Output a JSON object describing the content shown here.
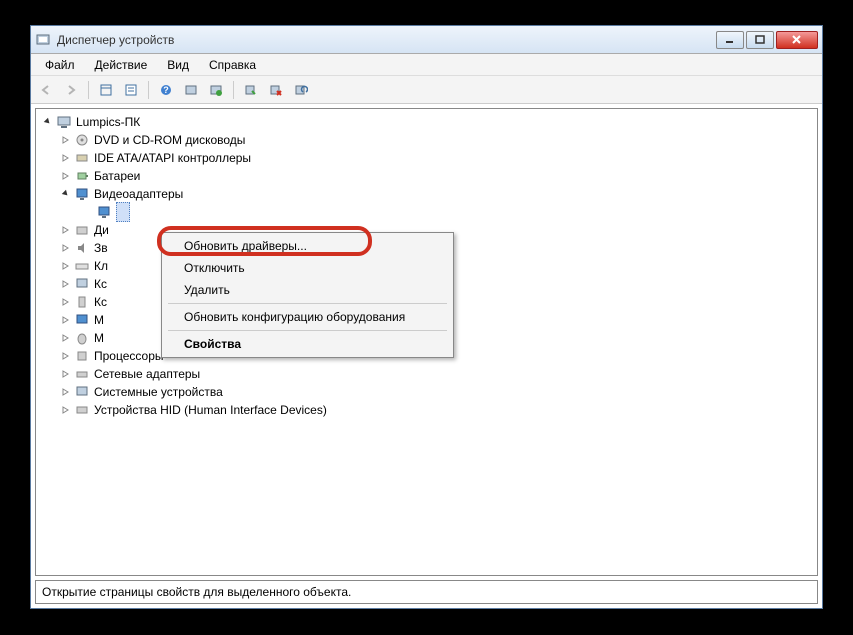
{
  "window": {
    "title": "Диспетчер устройств"
  },
  "menu": {
    "file": "Файл",
    "action": "Действие",
    "view": "Вид",
    "help": "Справка"
  },
  "tree": {
    "root": "Lumpics-ПК",
    "items": [
      {
        "label": "DVD и CD-ROM дисководы"
      },
      {
        "label": "IDE ATA/ATAPI контроллеры"
      },
      {
        "label": "Батареи"
      },
      {
        "label": "Видеоадаптеры"
      },
      {
        "label": "Ди"
      },
      {
        "label": "Зв"
      },
      {
        "label": "Кл"
      },
      {
        "label": "Кс"
      },
      {
        "label": "Кс"
      },
      {
        "label": "М"
      },
      {
        "label": "М"
      },
      {
        "label": "Процессоры"
      },
      {
        "label": "Сетевые адаптеры"
      },
      {
        "label": "Системные устройства"
      },
      {
        "label": "Устройства HID (Human Interface Devices)"
      }
    ]
  },
  "context": {
    "update_drivers": "Обновить драйверы...",
    "disable": "Отключить",
    "uninstall": "Удалить",
    "scan_hw": "Обновить конфигурацию оборудования",
    "properties": "Свойства"
  },
  "status": "Открытие страницы свойств для выделенного объекта."
}
